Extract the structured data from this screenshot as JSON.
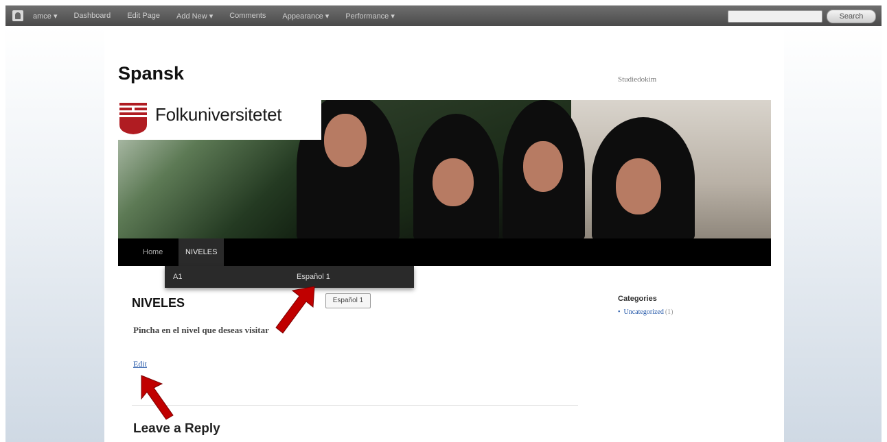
{
  "admin_bar": {
    "items": [
      "amce ▾",
      "Dashboard",
      "Edit Page",
      "Add New ▾",
      "Comments",
      "Appearance ▾",
      "Performance ▾"
    ],
    "search_button": "Search"
  },
  "site": {
    "title": "Spansk",
    "description": "Studiedokim",
    "logo_text": "Folkuniversitetet"
  },
  "nav": {
    "items": [
      "Home",
      "NIVELES"
    ],
    "active": "NIVELES",
    "dropdown": [
      "A1",
      "Español 1"
    ]
  },
  "main": {
    "title": "NIVELES",
    "button_label": "Español 1",
    "text": "Pincha en el nivel que deseas visitar",
    "edit_label": "Edit",
    "reply_title": "Leave a Reply"
  },
  "sidebar": {
    "title": "Categories",
    "items": [
      {
        "label": "Uncategorized",
        "count": "(1)"
      }
    ]
  },
  "colors": {
    "annotation_arrow": "#c00000",
    "logo_red": "#b01c22",
    "link": "#2357a8"
  }
}
